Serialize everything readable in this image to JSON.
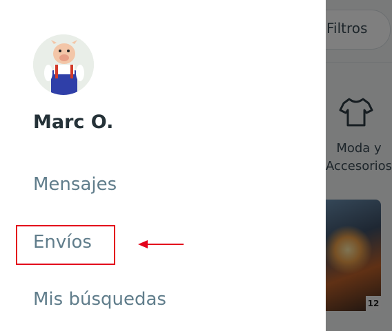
{
  "background": {
    "filters_label": "Filtros",
    "category_label": "Moda y Accesorios",
    "category_icon": "tshirt-icon",
    "game_badge": "12"
  },
  "drawer": {
    "user_name": "Marc O.",
    "avatar_icon": "avatar-cartoon-pig",
    "menu_items": [
      {
        "label": "Mensajes"
      },
      {
        "label": "Envíos"
      },
      {
        "label": "Mis búsquedas"
      }
    ]
  },
  "annotation": {
    "color": "#e3001b"
  }
}
